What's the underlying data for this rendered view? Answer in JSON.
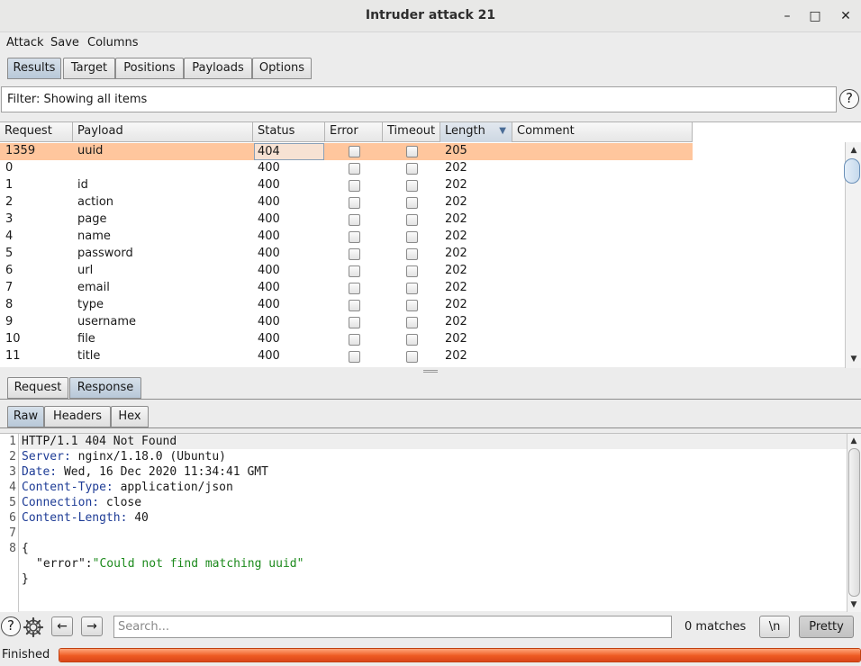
{
  "window": {
    "title": "Intruder attack 21",
    "minimize": "–",
    "maximize": "□",
    "close": "✕"
  },
  "menu": [
    "Attack",
    "Save",
    "Columns"
  ],
  "main_tabs": [
    "Results",
    "Target",
    "Positions",
    "Payloads",
    "Options"
  ],
  "filter": {
    "text": "Filter: Showing all items",
    "help": "?"
  },
  "table": {
    "columns": [
      "Request",
      "Payload",
      "Status",
      "Error",
      "Timeout",
      "Length",
      "Comment"
    ],
    "sorted_column": "Length",
    "rows": [
      {
        "request": "1359",
        "payload": "uuid",
        "status": "404",
        "length": "205"
      },
      {
        "request": "0",
        "payload": "",
        "status": "400",
        "length": "202"
      },
      {
        "request": "1",
        "payload": "id",
        "status": "400",
        "length": "202"
      },
      {
        "request": "2",
        "payload": "action",
        "status": "400",
        "length": "202"
      },
      {
        "request": "3",
        "payload": "page",
        "status": "400",
        "length": "202"
      },
      {
        "request": "4",
        "payload": "name",
        "status": "400",
        "length": "202"
      },
      {
        "request": "5",
        "payload": "password",
        "status": "400",
        "length": "202"
      },
      {
        "request": "6",
        "payload": "url",
        "status": "400",
        "length": "202"
      },
      {
        "request": "7",
        "payload": "email",
        "status": "400",
        "length": "202"
      },
      {
        "request": "8",
        "payload": "type",
        "status": "400",
        "length": "202"
      },
      {
        "request": "9",
        "payload": "username",
        "status": "400",
        "length": "202"
      },
      {
        "request": "10",
        "payload": "file",
        "status": "400",
        "length": "202"
      },
      {
        "request": "11",
        "payload": "title",
        "status": "400",
        "length": "202"
      }
    ]
  },
  "detail_tabs": [
    "Request",
    "Response"
  ],
  "view_tabs": [
    "Raw",
    "Headers",
    "Hex"
  ],
  "response": {
    "line_numbers": [
      "1",
      "2",
      "3",
      "4",
      "5",
      "6",
      "7",
      "8"
    ],
    "status_line": "HTTP/1.1 404 Not Found",
    "headers": [
      {
        "name": "Server:",
        "value": " nginx/1.18.0 (Ubuntu)"
      },
      {
        "name": "Date:",
        "value": " Wed, 16 Dec 2020 11:34:41 GMT"
      },
      {
        "name": "Content-Type:",
        "value": " application/json"
      },
      {
        "name": "Connection:",
        "value": " close"
      },
      {
        "name": "Content-Length:",
        "value": " 40"
      }
    ],
    "body_open": "{",
    "body_key": "\"error\"",
    "body_colon": ":",
    "body_value": "\"Could not find matching uuid\"",
    "body_close": "}"
  },
  "search": {
    "placeholder": "Search...",
    "matches": "0 matches",
    "newline_btn": "\\n",
    "pretty_btn": "Pretty"
  },
  "status": {
    "text": "Finished",
    "progress": 1.0
  },
  "colors": {
    "selected_row": "#ffc69d",
    "progress": "#ee5a22",
    "header_key": "#1e3c96",
    "json_string": "#1c8a1c"
  }
}
